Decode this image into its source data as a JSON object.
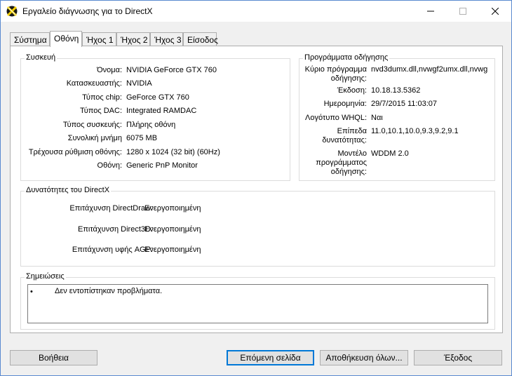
{
  "window": {
    "title": "Εργαλείο διάγνωσης για το DirectX"
  },
  "tabs": [
    {
      "label": "Σύστημα"
    },
    {
      "label": "Οθόνη"
    },
    {
      "label": "Ήχος 1"
    },
    {
      "label": "Ήχος 2"
    },
    {
      "label": "Ήχος 3"
    },
    {
      "label": "Είσοδος"
    }
  ],
  "device": {
    "title": "Συσκευή",
    "rows": [
      {
        "label": "Όνομα:",
        "value": "NVIDIA GeForce GTX 760"
      },
      {
        "label": "Κατασκευαστής:",
        "value": "NVIDIA"
      },
      {
        "label": "Τύπος chip:",
        "value": "GeForce GTX 760"
      },
      {
        "label": "Τύπος DAC:",
        "value": "Integrated RAMDAC"
      },
      {
        "label": "Τύπος συσκευής:",
        "value": "Πλήρης οθόνη"
      },
      {
        "label": "Συνολική μνήμη",
        "value": "6075 MB"
      },
      {
        "label": "Τρέχουσα ρύθμιση οθόνης:",
        "value": "1280 x 1024 (32 bit) (60Hz)"
      },
      {
        "label": "Οθόνη:",
        "value": "Generic PnP Monitor"
      }
    ]
  },
  "drivers": {
    "title": "Προγράμματα οδήγησης",
    "main_driver_label_1": "Κύριο πρόγραμμα",
    "main_driver_label_2": "οδήγησης:",
    "main_driver_value": "nvd3dumx.dll,nvwgf2umx.dll,nvwg",
    "version_label": "Έκδοση:",
    "version_value": "10.18.13.5362",
    "date_label": "Ημερομηνία:",
    "date_value": "29/7/2015 11:03:07",
    "whql_label": "Λογότυπο WHQL:",
    "whql_value": "Ναι",
    "levels_label_1": "Επίπεδα",
    "levels_label_2": "δυνατότητας:",
    "levels_value": "11.0,10.1,10.0,9.3,9.2,9.1",
    "model_label_1": "Μοντέλο",
    "model_label_2": "προγράμματος",
    "model_label_3": "οδήγησης:",
    "model_value": "WDDM 2.0"
  },
  "features": {
    "title": "Δυνατότητες του DirectX",
    "rows": [
      {
        "label": "Επιτάχυνση DirectDraw:",
        "value": "Ενεργοποιημένη"
      },
      {
        "label": "Επιτάχυνση Direct3D:",
        "value": "Ενεργοποιημένη"
      },
      {
        "label": "Επιτάχυνση υφής AGP:",
        "value": "Ενεργοποιημένη"
      }
    ]
  },
  "notes": {
    "title": "Σημειώσεις",
    "bullet": "•",
    "text": "Δεν εντοπίστηκαν προβλήματα."
  },
  "buttons": {
    "help": "Βοήθεια",
    "next": "Επόμενη σελίδα",
    "save": "Αποθήκευση όλων...",
    "exit": "Έξοδος"
  },
  "icons": {
    "app": "directx-icon",
    "minimize": "minimize-icon",
    "maximize": "maximize-icon",
    "close": "close-icon"
  }
}
